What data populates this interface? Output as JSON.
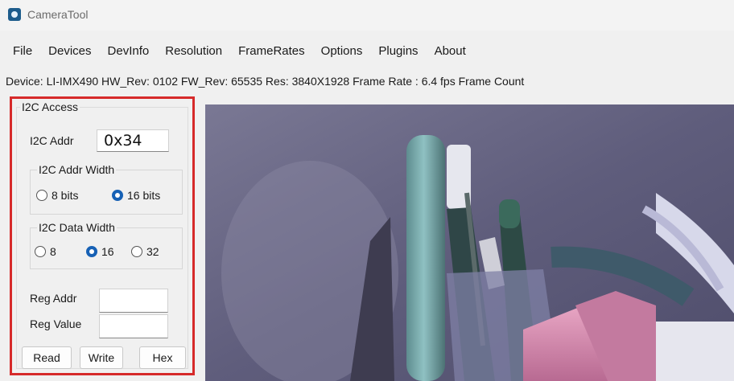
{
  "window": {
    "title": "CameraTool"
  },
  "menu": [
    "File",
    "Devices",
    "DevInfo",
    "Resolution",
    "FrameRates",
    "Options",
    "Plugins",
    "About"
  ],
  "status": {
    "text": "Device:  LI-IMX490  HW_Rev:  0102  FW_Rev:  65535  Res:  3840X1928  Frame Rate :  6.4 fps  Frame Count"
  },
  "i2c": {
    "group_title": "I2C Access",
    "addr_label": "I2C Addr",
    "addr_value": "0x34",
    "addr_width": {
      "title": "I2C Addr Width",
      "options": [
        "8 bits",
        "16 bits"
      ],
      "selected": "16 bits"
    },
    "data_width": {
      "title": "I2C Data Width",
      "options": [
        "8",
        "16",
        "32"
      ],
      "selected": "16"
    },
    "reg_addr_label": "Reg Addr",
    "reg_addr_value": "",
    "reg_value_label": "Reg Value",
    "reg_value_value": "",
    "buttons": {
      "read": "Read",
      "write": "Write",
      "hex": "Hex"
    }
  },
  "colors": {
    "highlight_border": "#d62a2a",
    "radio_selected": "#1761b5",
    "app_icon": "#1d5c8c"
  }
}
